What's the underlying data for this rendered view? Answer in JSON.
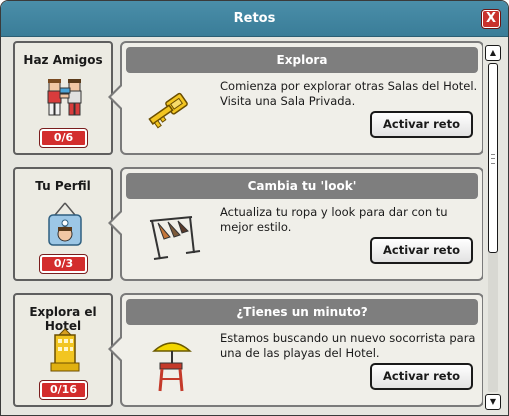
{
  "window": {
    "title": "Retos",
    "close_label": "X"
  },
  "challenges": [
    {
      "name": "Haz Amigos",
      "progress": "0/6",
      "progress_fraction": 0.0,
      "icon": "two-avatars-handshake-icon",
      "header": "Explora",
      "description": "Comienza por explorar otras Salas del Hotel. Visita una Sala Privada.",
      "illustration": "golden-key-icon",
      "button_label": "Activar reto"
    },
    {
      "name": "Tu Perfil",
      "progress": "0/3",
      "progress_fraction": 0.0,
      "icon": "profile-tag-icon",
      "header": "Cambia tu 'look'",
      "description": "Actualiza tu ropa y look para dar con tu mejor estilo.",
      "illustration": "clothes-rack-icon",
      "button_label": "Activar reto"
    },
    {
      "name": "Explora el Hotel",
      "progress": "0/16",
      "progress_fraction": 0.0,
      "icon": "hotel-building-icon",
      "header": "¿Tienes un minuto?",
      "description": "Estamos buscando un nuevo socorrista para una de las playas del Hotel.",
      "illustration": "lifeguard-chair-icon",
      "button_label": "Activar reto"
    }
  ],
  "colors": {
    "titlebar": "#3a7d98",
    "badge": "#d32d2d",
    "close": "#c8322d",
    "card_header": "#7e7e7e"
  }
}
